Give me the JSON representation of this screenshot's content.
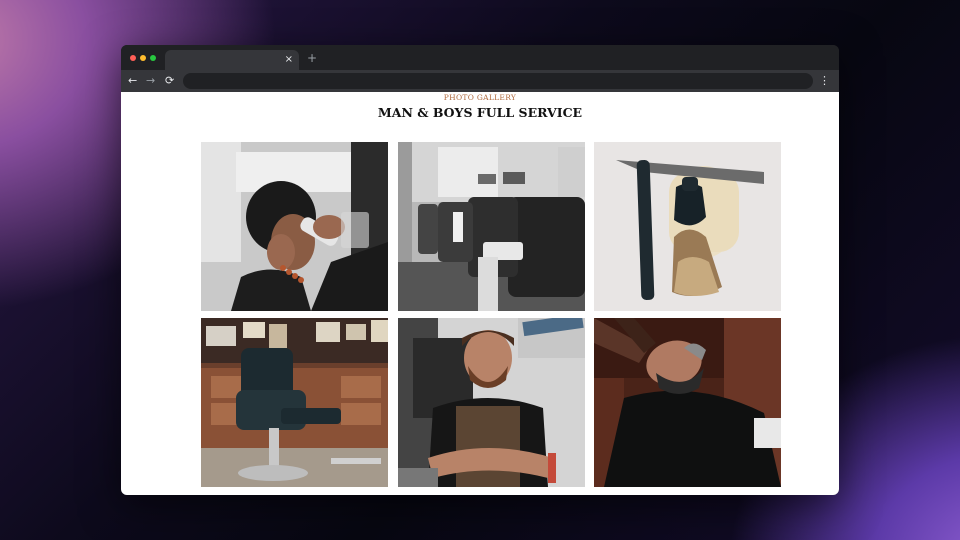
{
  "browser": {
    "tab": {
      "close_glyph": "×"
    },
    "new_tab_glyph": "+",
    "nav": {
      "back": "←",
      "forward": "→",
      "reload": "⟳",
      "menu": "⋮"
    },
    "url": ""
  },
  "gallery": {
    "eyebrow": "PHOTO GALLERY",
    "title": "MAN & BOYS FULL SERVICE"
  }
}
